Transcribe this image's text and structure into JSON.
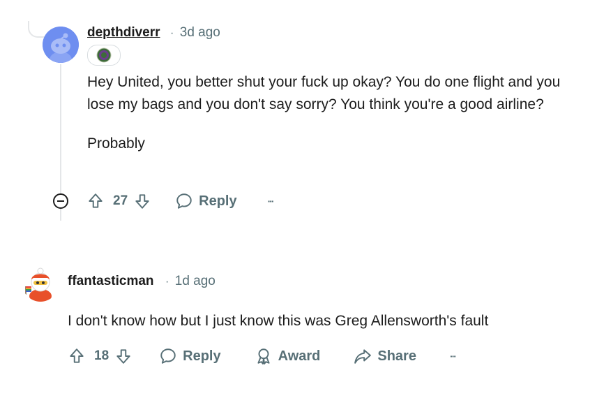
{
  "comments": [
    {
      "username": "depthdiverr",
      "separator": "·",
      "time": "3d ago",
      "paragraphs": [
        "Hey United, you better shut your fuck up okay? You do one flight and you lose my bags and you don't say sorry? You think you're a good airline?",
        "Probably"
      ],
      "score": "27",
      "reply_label": "Reply",
      "more_label": "···"
    },
    {
      "username": "ffantasticman",
      "separator": "·",
      "time": "1d ago",
      "paragraphs": [
        "I don't know how but I just know this was Greg Allensworth's fault"
      ],
      "score": "18",
      "reply_label": "Reply",
      "award_label": "Award",
      "share_label": "Share",
      "more_label": "···"
    }
  ],
  "colors": {
    "meta": "#576f76",
    "text": "#1c1c1c",
    "thread_line": "#e4e6e8",
    "avatar_bg": "#6e8ef0"
  }
}
